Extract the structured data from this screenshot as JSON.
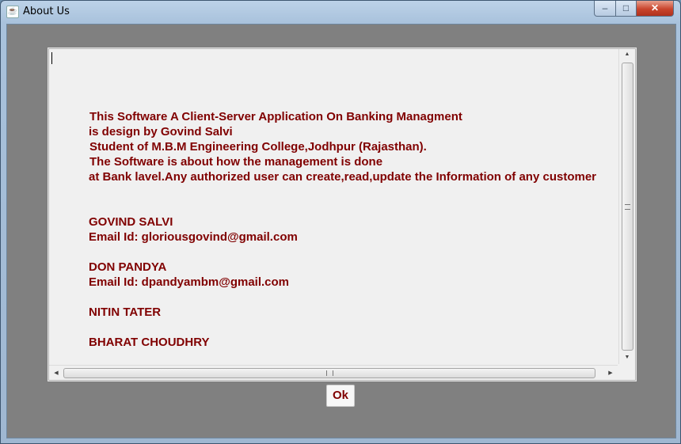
{
  "window": {
    "title": "About Us",
    "minimize_glyph": "–",
    "maximize_glyph": "□",
    "close_glyph": "✕"
  },
  "about": {
    "lines": [
      "This Software A Client-Server Application On Banking Managment",
      "is design by Govind Salvi",
      "Student of M.B.M Engineering College,Jodhpur (Rajasthan).",
      "The Software is about how the management is done",
      "at Bank lavel.Any authorized user can create,read,update the Information of any customer",
      "GOVIND SALVI",
      "Email Id: gloriousgovind@gmail.com",
      "DON PANDYA",
      "Email Id: dpandyambm@gmail.com",
      "NITIN TATER",
      "BHARAT CHOUDHRY"
    ]
  },
  "ok_button": {
    "label": "Ok"
  },
  "colors": {
    "text": "#800000",
    "client_bg": "#808080",
    "panel_bg": "#f0f0f0"
  },
  "icons": [
    "java-app-icon",
    "minimize-icon",
    "maximize-icon",
    "close-icon",
    "scroll-up-icon",
    "scroll-down-icon",
    "scroll-left-icon",
    "scroll-right-icon"
  ]
}
